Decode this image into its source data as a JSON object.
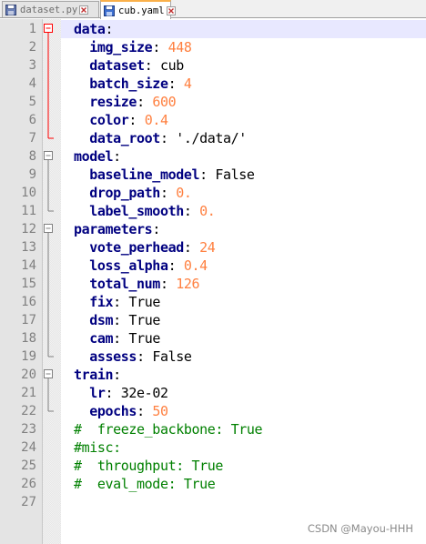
{
  "tabs": [
    {
      "label": "dataset.py",
      "active": false,
      "icon": "save-disk-icon"
    },
    {
      "label": "cub.yaml",
      "active": true,
      "icon": "save-disk-icon"
    }
  ],
  "lines": [
    {
      "num": "1",
      "parts": [
        [
          "k",
          "data"
        ],
        [
          "c",
          ":"
        ]
      ]
    },
    {
      "num": "2",
      "parts": [
        [
          "sp",
          "  "
        ],
        [
          "k",
          "img_size"
        ],
        [
          "c",
          ": "
        ],
        [
          "n",
          "448"
        ]
      ]
    },
    {
      "num": "3",
      "parts": [
        [
          "sp",
          "  "
        ],
        [
          "k",
          "dataset"
        ],
        [
          "c",
          ": cub"
        ]
      ]
    },
    {
      "num": "4",
      "parts": [
        [
          "sp",
          "  "
        ],
        [
          "k",
          "batch_size"
        ],
        [
          "c",
          ": "
        ],
        [
          "n",
          "4"
        ]
      ]
    },
    {
      "num": "5",
      "parts": [
        [
          "sp",
          "  "
        ],
        [
          "k",
          "resize"
        ],
        [
          "c",
          ": "
        ],
        [
          "n",
          "600"
        ]
      ]
    },
    {
      "num": "6",
      "parts": [
        [
          "sp",
          "  "
        ],
        [
          "k",
          "color"
        ],
        [
          "c",
          ": "
        ],
        [
          "n",
          "0.4"
        ]
      ]
    },
    {
      "num": "7",
      "parts": [
        [
          "sp",
          "  "
        ],
        [
          "k",
          "data_root"
        ],
        [
          "c",
          ": './data/'"
        ]
      ]
    },
    {
      "num": "8",
      "parts": [
        [
          "k",
          "model"
        ],
        [
          "c",
          ":"
        ]
      ]
    },
    {
      "num": "9",
      "parts": [
        [
          "sp",
          "  "
        ],
        [
          "k",
          "baseline_model"
        ],
        [
          "c",
          ": False"
        ]
      ]
    },
    {
      "num": "10",
      "parts": [
        [
          "sp",
          "  "
        ],
        [
          "k",
          "drop_path"
        ],
        [
          "c",
          ": "
        ],
        [
          "n",
          "0."
        ]
      ]
    },
    {
      "num": "11",
      "parts": [
        [
          "sp",
          "  "
        ],
        [
          "k",
          "label_smooth"
        ],
        [
          "c",
          ": "
        ],
        [
          "n",
          "0."
        ]
      ]
    },
    {
      "num": "12",
      "parts": [
        [
          "k",
          "parameters"
        ],
        [
          "c",
          ":"
        ]
      ]
    },
    {
      "num": "13",
      "parts": [
        [
          "sp",
          "  "
        ],
        [
          "k",
          "vote_perhead"
        ],
        [
          "c",
          ": "
        ],
        [
          "n",
          "24"
        ]
      ]
    },
    {
      "num": "14",
      "parts": [
        [
          "sp",
          "  "
        ],
        [
          "k",
          "loss_alpha"
        ],
        [
          "c",
          ": "
        ],
        [
          "n",
          "0.4"
        ]
      ]
    },
    {
      "num": "15",
      "parts": [
        [
          "sp",
          "  "
        ],
        [
          "k",
          "total_num"
        ],
        [
          "c",
          ": "
        ],
        [
          "n",
          "126"
        ]
      ]
    },
    {
      "num": "16",
      "parts": [
        [
          "sp",
          "  "
        ],
        [
          "k",
          "fix"
        ],
        [
          "c",
          ": True"
        ]
      ]
    },
    {
      "num": "17",
      "parts": [
        [
          "sp",
          "  "
        ],
        [
          "k",
          "dsm"
        ],
        [
          "c",
          ": True"
        ]
      ]
    },
    {
      "num": "18",
      "parts": [
        [
          "sp",
          "  "
        ],
        [
          "k",
          "cam"
        ],
        [
          "c",
          ": True"
        ]
      ]
    },
    {
      "num": "19",
      "parts": [
        [
          "sp",
          "  "
        ],
        [
          "k",
          "assess"
        ],
        [
          "c",
          ": False"
        ]
      ]
    },
    {
      "num": "20",
      "parts": [
        [
          "k",
          "train"
        ],
        [
          "c",
          ":"
        ]
      ]
    },
    {
      "num": "21",
      "parts": [
        [
          "sp",
          "  "
        ],
        [
          "k",
          "lr"
        ],
        [
          "c",
          ": 32e-02"
        ]
      ]
    },
    {
      "num": "22",
      "parts": [
        [
          "sp",
          "  "
        ],
        [
          "k",
          "epochs"
        ],
        [
          "c",
          ": "
        ],
        [
          "n",
          "50"
        ]
      ]
    },
    {
      "num": "23",
      "parts": [
        [
          "cm",
          "#  freeze_backbone: True"
        ]
      ]
    },
    {
      "num": "24",
      "parts": [
        [
          "cm",
          "#misc:"
        ]
      ]
    },
    {
      "num": "25",
      "parts": [
        [
          "cm",
          "#  throughput: True"
        ]
      ]
    },
    {
      "num": "26",
      "parts": [
        [
          "cm",
          "#  eval_mode: True"
        ]
      ]
    },
    {
      "num": "27",
      "parts": []
    }
  ],
  "watermark": "CSDN @Mayou-HHH",
  "colors": {
    "keyword": "#000080",
    "number": "#ff8040",
    "comment": "#008000",
    "line_highlight": "#e8e8ff",
    "fold_active": "#ff0000"
  }
}
